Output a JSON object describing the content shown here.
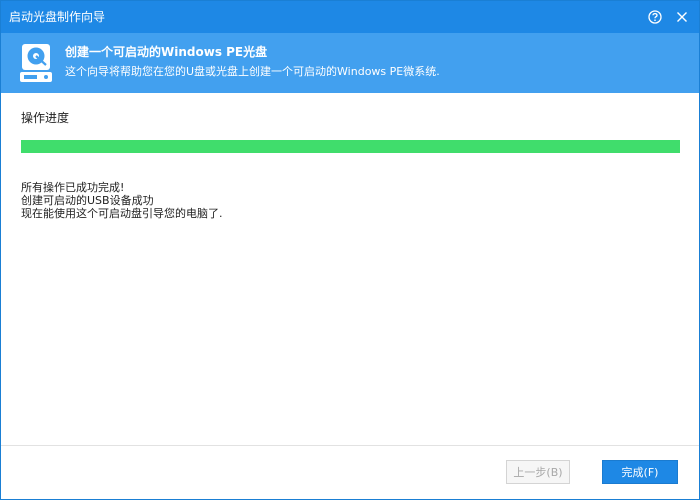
{
  "window": {
    "title": "启动光盘制作向导"
  },
  "banner": {
    "title": "创建一个可启动的Windows PE光盘",
    "subtitle": "这个向导将帮助您在您的U盘或光盘上创建一个可启动的Windows PE微系统."
  },
  "progress": {
    "label": "操作进度",
    "percent": 100
  },
  "messages": [
    "所有操作已成功完成!",
    "创建可启动的USB设备成功",
    "现在能使用这个可启动盘引导您的电脑了."
  ],
  "footer": {
    "prev_label": "上一步(B)",
    "finish_label": "完成(F)"
  },
  "colors": {
    "titlebar": "#1e88e5",
    "banner": "#42a0ef",
    "progress_fill": "#40dd6c",
    "primary_button": "#1e88e5"
  },
  "icons": {
    "title_help": "help-circle-icon",
    "title_close": "close-icon",
    "banner": "disk-drive-icon"
  }
}
